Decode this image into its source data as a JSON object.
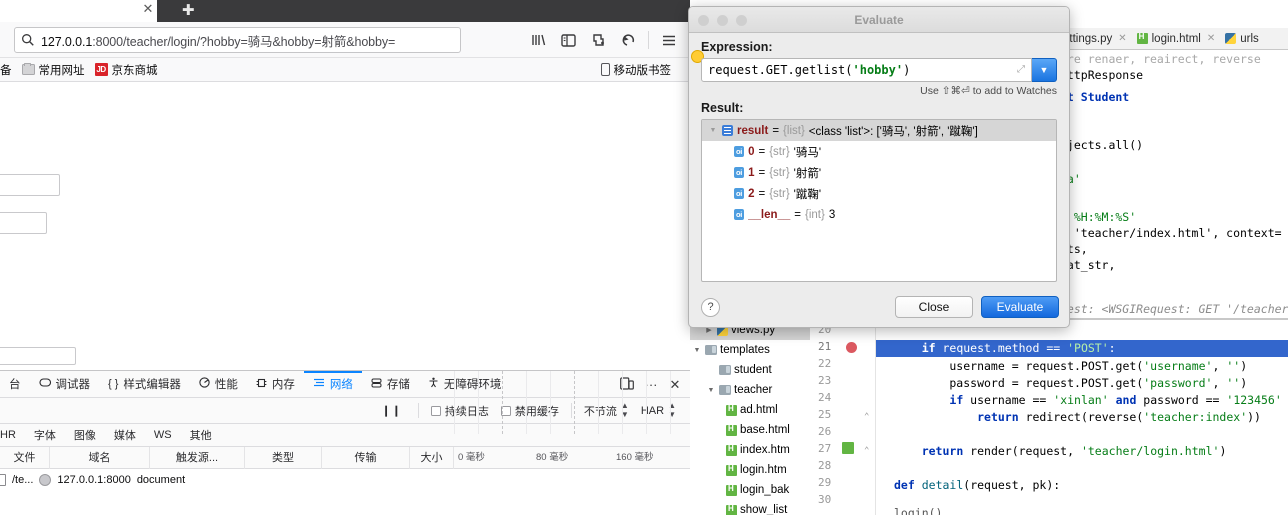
{
  "browser": {
    "tab_close_glyph": "✕",
    "newtab_glyph": "✚",
    "url_host": "127.0.0.1",
    "url_rest": ":8000/teacher/login/?hobby=骑马&hobby=射箭&hobby=",
    "toolbar_icons": [
      "library-icon",
      "sidebar-icon",
      "container-tabs-icon",
      "sync-icon",
      "hamburger-menu-icon"
    ],
    "bookmarks": [
      {
        "label": "备",
        "icon": "partial-bookmark"
      },
      {
        "label": "常用网址",
        "icon": "folder-icon"
      },
      {
        "label": "京东商城",
        "icon": "jd-icon",
        "badge": "JD"
      }
    ],
    "bookmarks_right": {
      "label": "移动版书签",
      "icon": "mobile-icon"
    }
  },
  "devtools": {
    "tabs": [
      {
        "label": "台",
        "icon": "console-icon",
        "active": false
      },
      {
        "label": "调试器",
        "icon": "debugger-icon",
        "active": false
      },
      {
        "label": "样式编辑器",
        "icon": "style-editor-icon",
        "active": false
      },
      {
        "label": "性能",
        "icon": "performance-icon",
        "active": false
      },
      {
        "label": "内存",
        "icon": "memory-icon",
        "active": false
      },
      {
        "label": "网络",
        "icon": "network-icon",
        "active": true
      },
      {
        "label": "存储",
        "icon": "storage-icon",
        "active": false
      },
      {
        "label": "无障碍环境",
        "icon": "accessibility-icon",
        "active": false
      }
    ],
    "right_icons": [
      "responsive-design-icon",
      "more-options-icon",
      "close-icon"
    ],
    "network_toolbar": {
      "pause_glyph": "❙❙",
      "persist_logs": "持续日志",
      "disable_cache": "禁用缓存",
      "throttling": "不节流",
      "har": "HAR"
    },
    "filters": [
      "HR",
      "字体",
      "图像",
      "媒体",
      "WS",
      "其他"
    ],
    "columns": [
      "文件",
      "域名",
      "触发源...",
      "类型",
      "传输",
      "大小"
    ],
    "timeline_ticks": [
      "0 毫秒",
      "80 毫秒",
      "160 毫秒"
    ],
    "rows": [
      {
        "file": "/te...",
        "domain": "127.0.0.1:8000",
        "type": "document"
      }
    ]
  },
  "ide": {
    "tabs": [
      {
        "label": "ettings.py",
        "icon": "python-file-icon",
        "close": "✕"
      },
      {
        "label": "login.html",
        "icon": "html-file-icon",
        "close": "✕"
      },
      {
        "label": "urls",
        "icon": "python-file-icon",
        "close": ""
      }
    ],
    "top_code": [
      "are renaer, reairect, reverse",
      "HttpResponse",
      "rt Student",
      "bjects.all()",
      "'a'",
      "d %H:%M:%S'",
      ", 'teacher/index.html', context=",
      "nts,",
      "nat_str,",
      "uest: <WSGIRequest: GET '/teacher"
    ],
    "tree": [
      {
        "label": "views.py",
        "icon": "python-file-icon",
        "indent": 1,
        "arrow": "▶",
        "selected": true
      },
      {
        "label": "templates",
        "icon": "folder-icon",
        "indent": 0,
        "arrow": "▼",
        "selected": false
      },
      {
        "label": "student",
        "icon": "folder-icon",
        "indent": 1,
        "arrow": "",
        "selected": false
      },
      {
        "label": "teacher",
        "icon": "folder-icon",
        "indent": 1,
        "arrow": "▼",
        "selected": false
      },
      {
        "label": "ad.html",
        "icon": "html-file-icon",
        "indent": 2,
        "arrow": "",
        "selected": false
      },
      {
        "label": "base.html",
        "icon": "html-file-icon",
        "indent": 2,
        "arrow": "",
        "selected": false
      },
      {
        "label": "index.htm",
        "icon": "html-file-icon",
        "indent": 2,
        "arrow": "",
        "selected": false
      },
      {
        "label": "login.htm",
        "icon": "html-file-icon",
        "indent": 2,
        "arrow": "",
        "selected": false
      },
      {
        "label": "login_bak",
        "icon": "html-file-icon",
        "indent": 2,
        "arrow": "",
        "selected": false
      },
      {
        "label": "show_list",
        "icon": "html-file-icon",
        "indent": 2,
        "arrow": "",
        "selected": false
      }
    ],
    "line_numbers": [
      "20",
      "21",
      "22",
      "23",
      "24",
      "25",
      "26",
      "27",
      "28",
      "29",
      "30"
    ],
    "breakpoint_line": "21",
    "code_lines": [
      "    if request.method == 'POST':",
      "        username = request.POST.get('username', '')",
      "        password = request.POST.get('password', '')",
      "        if username == 'xinlan' and password == '123456'",
      "            return redirect(reverse('teacher:index'))",
      "    return render(request, 'teacher/login.html')",
      "def detail(request, pk):"
    ],
    "status_text": "login()"
  },
  "dialog": {
    "title": "Evaluate",
    "expression_label": "Expression:",
    "expression_value": "request.GET.getlist('hobby')",
    "expression_string_arg": "'hobby'",
    "expression_prefix": "request.GET.getlist(",
    "expression_suffix": ")",
    "hint": "Use ⇧⌘⏎ to add to Watches",
    "result_label": "Result:",
    "result_rows": [
      {
        "name": "result",
        "eq": "=",
        "type": "{list}",
        "value": "<class 'list'>: ['骑马', '射箭', '蹴鞠']",
        "icon": "list-icon",
        "indent": 0,
        "selected": true
      },
      {
        "name": "0",
        "eq": "=",
        "type": "{str}",
        "value": "'骑马'",
        "icon": "object-icon",
        "indent": 1,
        "selected": false
      },
      {
        "name": "1",
        "eq": "=",
        "type": "{str}",
        "value": "'射箭'",
        "icon": "object-icon",
        "indent": 1,
        "selected": false
      },
      {
        "name": "2",
        "eq": "=",
        "type": "{str}",
        "value": "'蹴鞠'",
        "icon": "object-icon",
        "indent": 1,
        "selected": false
      },
      {
        "name": "__len__",
        "eq": "=",
        "type": "{int}",
        "value": "3",
        "icon": "object-icon",
        "indent": 1,
        "selected": false
      }
    ],
    "help_glyph": "?",
    "close_label": "Close",
    "evaluate_label": "Evaluate",
    "accent_color": "#1368dd"
  }
}
